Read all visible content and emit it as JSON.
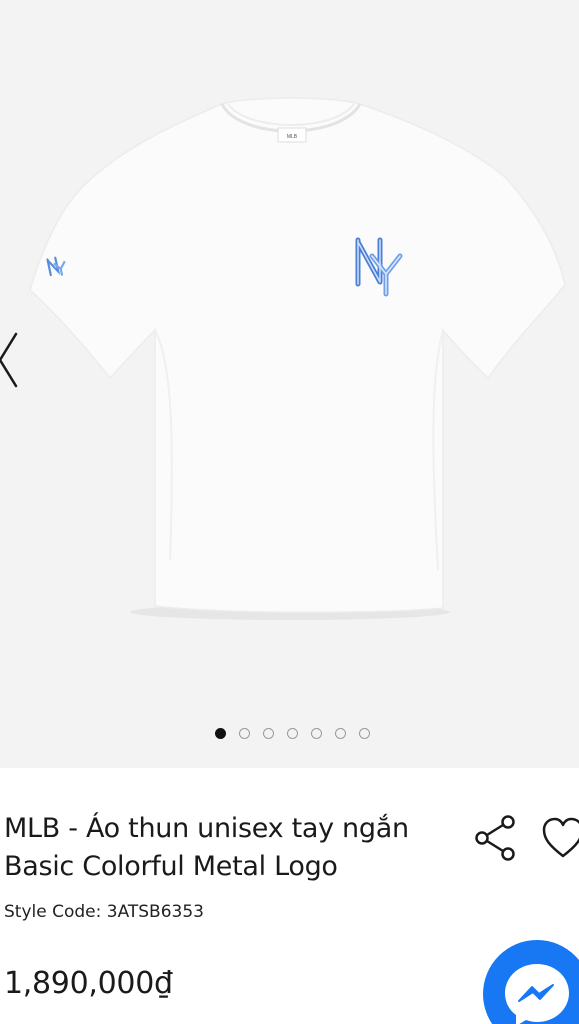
{
  "gallery": {
    "image_alt": "White MLB unisex short sleeve t-shirt with blue NY metal logo",
    "slide_count": 7,
    "active_slide": 1
  },
  "product": {
    "title": "MLB - Áo thun unisex tay ngắn Basic Colorful Metal Logo",
    "style_code": "Style Code: 3ATSB6353",
    "price": "1,890,000₫"
  },
  "colors": {
    "gallery_bg": "#f3f3f3",
    "shirt": "#fafafa",
    "logo_blue": "#4a7fd4",
    "messenger_blue": "#1877f2"
  },
  "icons": {
    "prev": "chevron-left-icon",
    "share": "share-icon",
    "favorite": "heart-icon",
    "messenger": "messenger-icon"
  }
}
